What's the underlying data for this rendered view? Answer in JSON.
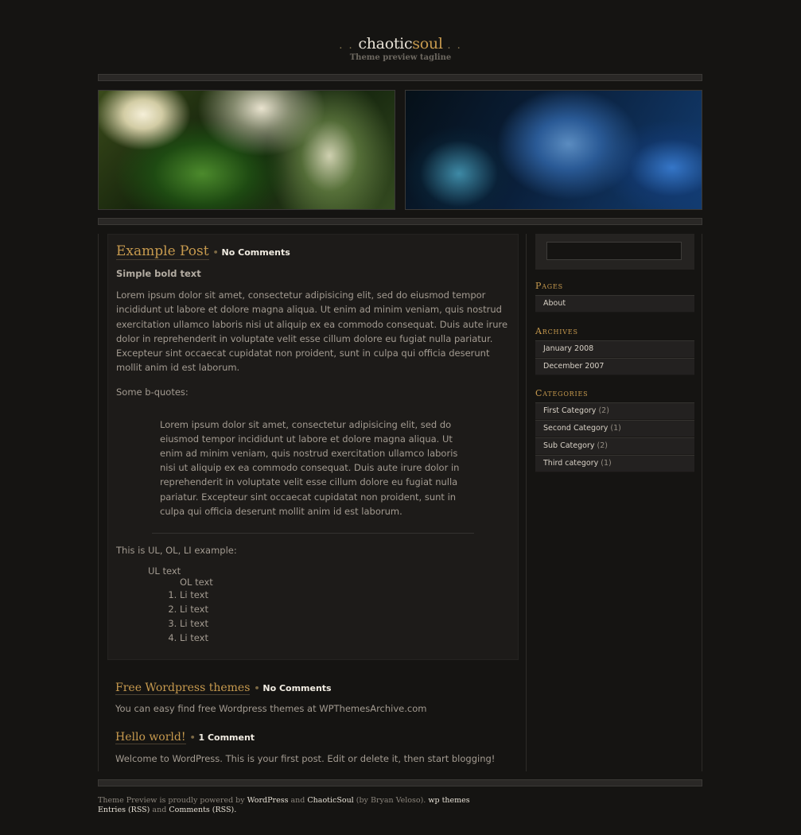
{
  "header": {
    "dots_left": ". .",
    "title_part1": "chaotic",
    "title_part2": "soul",
    "dots_right": ". .",
    "tagline": "Theme preview tagline"
  },
  "posts": [
    {
      "title": "Example Post",
      "separator": "•",
      "comments": "No Comments",
      "bold_text": "Simple bold text",
      "paragraph": "Lorem ipsum dolor sit amet, consectetur adipisicing elit, sed do eiusmod tempor incididunt ut labore et dolore magna aliqua. Ut enim ad minim veniam, quis nostrud exercitation ullamco laboris nisi ut aliquip ex ea commodo consequat. Duis aute irure dolor in reprehenderit in voluptate velit esse cillum dolore eu fugiat nulla pariatur. Excepteur sint occaecat cupidatat non proident, sunt in culpa qui officia deserunt mollit anim id est laborum.",
      "bquote_intro": "Some b-quotes:",
      "blockquote": "Lorem ipsum dolor sit amet, consectetur adipisicing elit, sed do eiusmod tempor incididunt ut labore et dolore magna aliqua. Ut enim ad minim veniam, quis nostrud exercitation ullamco laboris nisi ut aliquip ex ea commodo consequat. Duis aute irure dolor in reprehenderit in voluptate velit esse cillum dolore eu fugiat nulla pariatur. Excepteur sint occaecat cupidatat non proident, sunt in culpa qui officia deserunt mollit anim id est laborum.",
      "list_intro": "This is UL, OL, LI example:",
      "ul_text": "UL text",
      "ol_text": "OL text",
      "list_items": [
        "Li text",
        "Li text",
        "Li text",
        "Li text"
      ]
    },
    {
      "title": "Free Wordpress themes",
      "separator": "•",
      "comments": "No Comments",
      "body": "You can easy find free Wordpress themes at WPThemesArchive.com"
    },
    {
      "title": "Hello world!",
      "separator": "•",
      "comments": "1 Comment",
      "body": "Welcome to WordPress. This is your first post. Edit or delete it, then start blogging!"
    }
  ],
  "sidebar": {
    "search": {
      "value": "",
      "placeholder": ""
    },
    "pages": {
      "title": "Pages",
      "items": [
        "About"
      ]
    },
    "archives": {
      "title": "Archives",
      "items": [
        "January 2008",
        "December 2007"
      ]
    },
    "categories": {
      "title": "Categories",
      "items": [
        {
          "name": "First Category",
          "count": "(2)"
        },
        {
          "name": "Second Category",
          "count": "(1)"
        },
        {
          "name": "Sub Category",
          "count": "(2)"
        },
        {
          "name": "Third category",
          "count": "(1)"
        }
      ]
    }
  },
  "footer": {
    "line1_a": "Theme Preview is proudly powered by",
    "wordpress_link": "WordPress",
    "and": "and",
    "chaoticsoul_link": "ChaoticSoul",
    "by": "(by Bryan Veloso).",
    "wp_themes_link": "wp themes",
    "entries_rss": "Entries (RSS)",
    "and2": "and",
    "comments_rss": "Comments (RSS)",
    "period": "."
  },
  "colors": {
    "background": "#151412",
    "accent": "#c79a4e",
    "panel": "#1d1b19",
    "text": "#a39b91"
  }
}
